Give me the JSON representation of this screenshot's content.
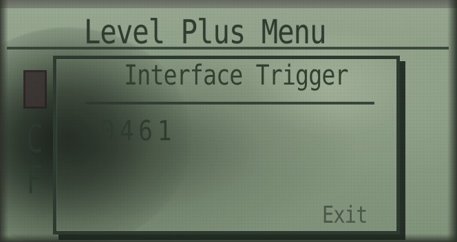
{
  "menu": {
    "title": "Level Plus Menu",
    "side_items": [
      "C",
      "F"
    ]
  },
  "dialog": {
    "title": "Interface Trigger",
    "value": "0461",
    "exit_label": "Exit"
  }
}
